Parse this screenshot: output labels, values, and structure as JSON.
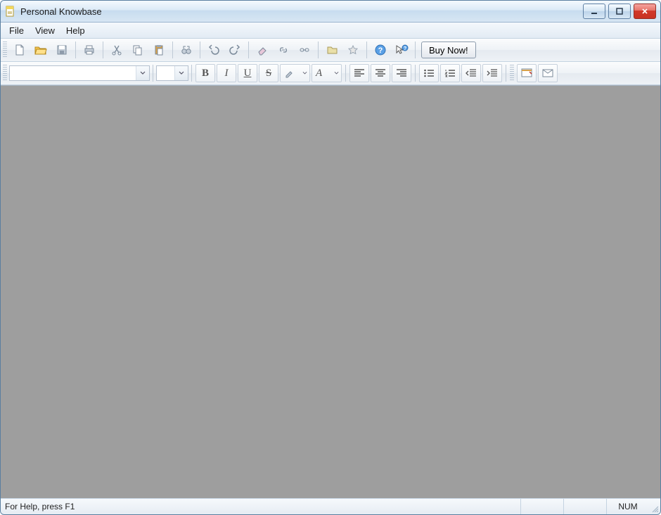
{
  "window": {
    "title": "Personal Knowbase"
  },
  "menu": {
    "file": "File",
    "view": "View",
    "help": "Help"
  },
  "toolbar1": {
    "buy_now": "Buy Now!"
  },
  "format": {
    "font_name": "",
    "font_size": ""
  },
  "status": {
    "help": "For Help, press F1",
    "num": "NUM"
  }
}
